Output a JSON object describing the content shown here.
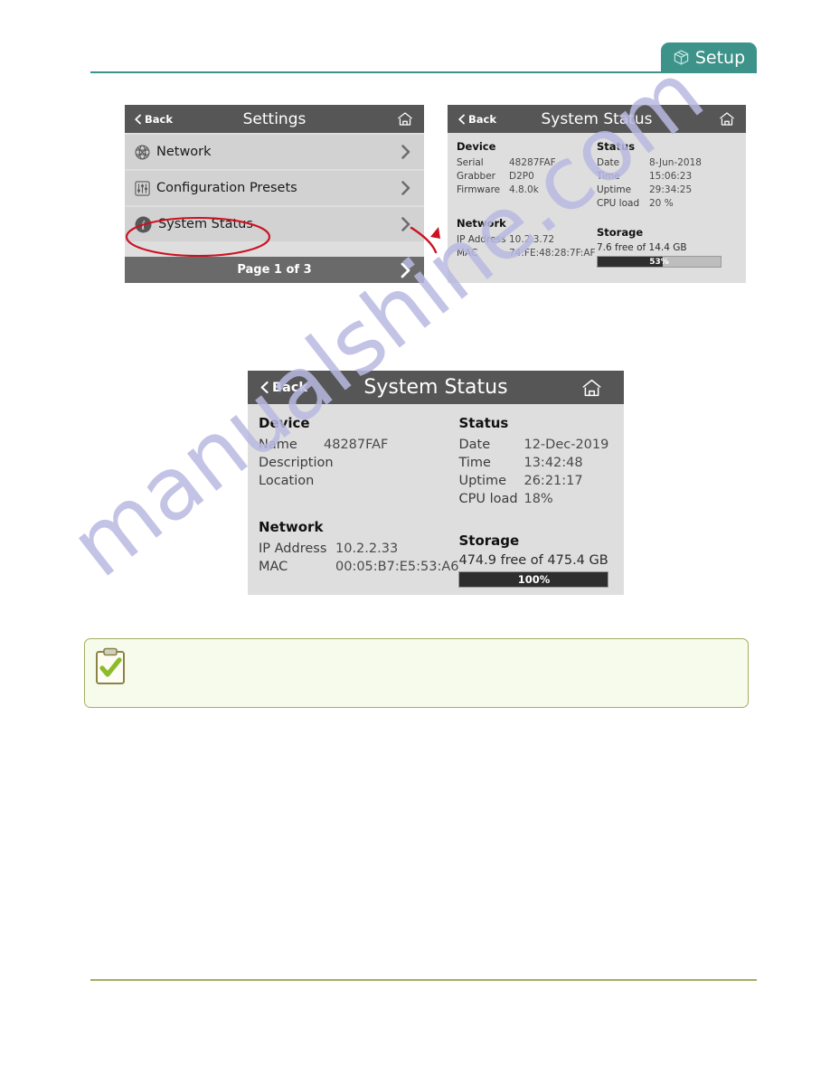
{
  "page": {
    "tab": {
      "label": "Setup",
      "icon": "box-icon",
      "color": "#3d9289"
    },
    "rule_top_color": "#3d9289",
    "rule_bottom_color": "#a6ad60",
    "watermark": "manualshine.com"
  },
  "settings_panel": {
    "back_label": "Back",
    "title": "Settings",
    "home_icon": "home-icon",
    "items": [
      {
        "label": "Network",
        "icon": "globe-icon"
      },
      {
        "label": "Configuration Presets",
        "icon": "sliders-icon"
      },
      {
        "label": "System Status",
        "icon": "info-icon"
      }
    ],
    "footer": {
      "label": "Page 1 of 3",
      "icon": "chevron-right-icon"
    }
  },
  "status_small": {
    "back_label": "Back",
    "title": "System Status",
    "home_icon": "home-icon",
    "device": {
      "heading": "Device",
      "rows": [
        {
          "key": "Serial",
          "value": "48287FAF"
        },
        {
          "key": "Grabber",
          "value": "D2P0"
        },
        {
          "key": "Firmware",
          "value": "4.8.0k"
        }
      ]
    },
    "status": {
      "heading": "Status",
      "rows": [
        {
          "key": "Date",
          "value": "8-Jun-2018"
        },
        {
          "key": "Time",
          "value": "15:06:23"
        },
        {
          "key": "Uptime",
          "value": "29:34:25"
        },
        {
          "key": "CPU load",
          "value": "20 %"
        }
      ]
    },
    "network": {
      "heading": "Network",
      "rows": [
        {
          "key": "IP Address",
          "value": "10.2.3.72"
        },
        {
          "key": "MAC",
          "value": "74:FE:48:28:7F:AF"
        }
      ]
    },
    "storage": {
      "heading": "Storage",
      "summary": "7.6 free of 14.4 GB",
      "bar_label": "53%",
      "bar_percent": 53
    }
  },
  "status_large": {
    "back_label": "Back",
    "title": "System Status",
    "home_icon": "home-icon",
    "device": {
      "heading": "Device",
      "rows": [
        {
          "key": "Name",
          "value": "48287FAF"
        },
        {
          "key": "Description",
          "value": ""
        },
        {
          "key": "Location",
          "value": ""
        }
      ]
    },
    "status": {
      "heading": "Status",
      "rows": [
        {
          "key": "Date",
          "value": "12-Dec-2019"
        },
        {
          "key": "Time",
          "value": "13:42:48"
        },
        {
          "key": "Uptime",
          "value": "26:21:17"
        },
        {
          "key": "CPU load",
          "value": "18%"
        }
      ]
    },
    "network": {
      "heading": "Network",
      "rows": [
        {
          "key": "IP Address",
          "value": "10.2.2.33"
        },
        {
          "key": "MAC",
          "value": "00:05:B7:E5:53:A6"
        }
      ]
    },
    "storage": {
      "heading": "Storage",
      "summary": "474.9 free of 475.4 GB",
      "bar_label": "100%",
      "bar_percent": 100
    }
  },
  "annotation": {
    "highlight_target": "System Status",
    "color": "#cc1122",
    "ellipse": "red-ellipse-highlight",
    "arrow": "red-curved-arrow"
  },
  "note": {
    "icon": "clipboard-check-icon",
    "text": ""
  }
}
